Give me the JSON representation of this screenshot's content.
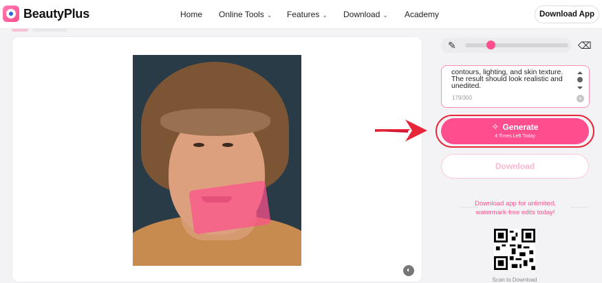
{
  "app": {
    "brand": "BeautyPlus"
  },
  "nav": {
    "items": [
      {
        "label": "Home",
        "has_dropdown": false
      },
      {
        "label": "Online Tools",
        "has_dropdown": true
      },
      {
        "label": "Features",
        "has_dropdown": true
      },
      {
        "label": "Download",
        "has_dropdown": true
      },
      {
        "label": "Academy",
        "has_dropdown": false
      }
    ],
    "download_app": "Download App"
  },
  "editor": {
    "photo_icon": "portrait-photo",
    "compare_icon": "compare-icon"
  },
  "tools": {
    "brush_icon": "brush-icon",
    "eraser_icon": "eraser-icon",
    "brush_size_fraction": 0.25
  },
  "prompt": {
    "text": "contours, lighting, and skin texture. The result should look realistic and unedited.",
    "count": "179/300"
  },
  "generate": {
    "label": "Generate",
    "sub": "4 Times Left Today",
    "icon": "sparkle-icon",
    "accent": "#ff4d8d",
    "highlight": "#e8263a"
  },
  "download": {
    "label": "Download"
  },
  "promo": {
    "text": "Download app for unlimited, watermark-free edits today!",
    "qr_caption": "Scan to Download"
  }
}
